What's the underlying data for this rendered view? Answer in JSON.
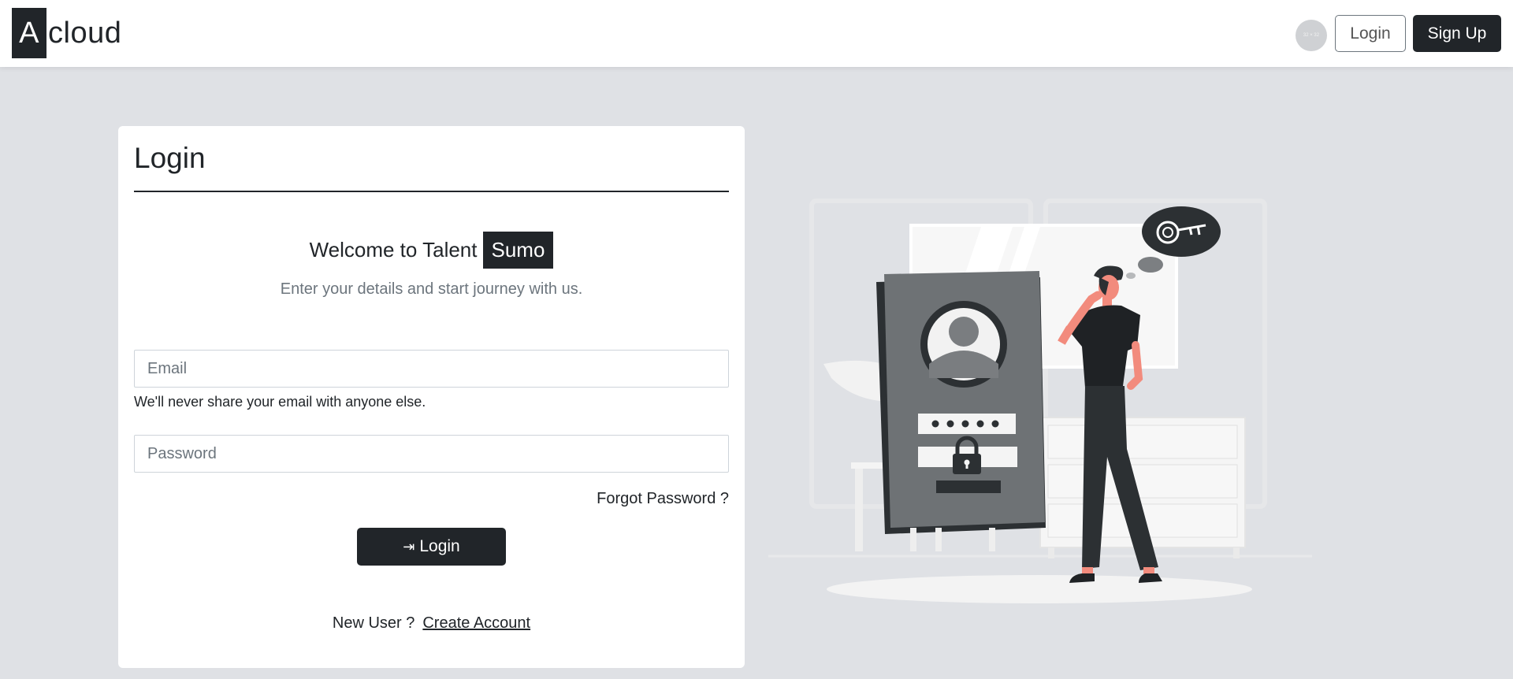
{
  "header": {
    "logo_mark": "A",
    "logo_text": "cloud",
    "avatar_text": "32 × 32",
    "login_label": "Login",
    "signup_label": "Sign Up"
  },
  "card": {
    "title": "Login",
    "welcome_text": "Welcome to Talent",
    "welcome_badge": "Sumo",
    "subtitle": "Enter your details and start journey with us.",
    "email_placeholder": "Email",
    "email_help": "We'll never share your email with anyone else.",
    "password_placeholder": "Password",
    "forgot_label": "Forgot Password ?",
    "login_icon": "⇥",
    "login_label": "Login",
    "new_user_label": "New User ?",
    "create_account_label": "Create Account"
  },
  "colors": {
    "page_bg": "#dfe1e5",
    "primary_dark": "#212529",
    "muted_text": "#6c757d",
    "accent_skin": "#f28b7d"
  }
}
